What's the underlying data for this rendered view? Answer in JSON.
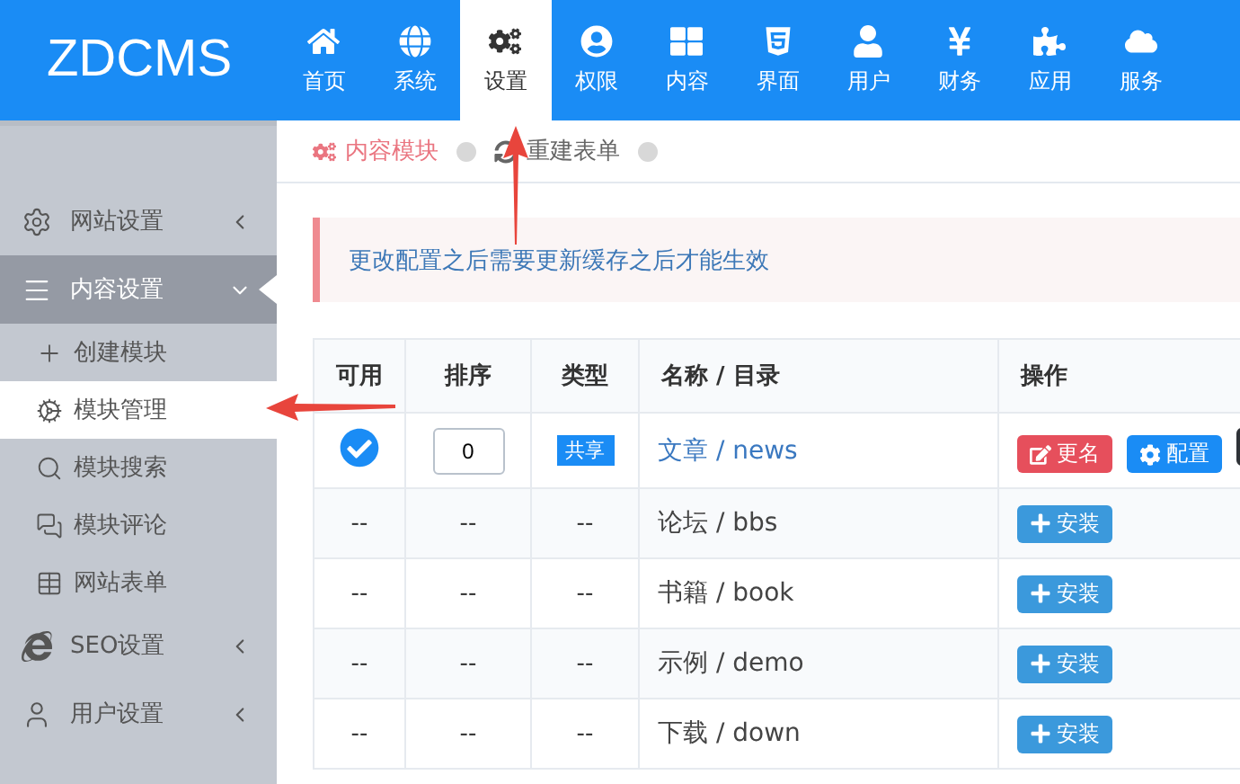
{
  "logo": "ZDCMS",
  "nav": [
    {
      "label": "首页",
      "selected": false
    },
    {
      "label": "系统",
      "selected": false
    },
    {
      "label": "设置",
      "selected": true
    },
    {
      "label": "权限",
      "selected": false
    },
    {
      "label": "内容",
      "selected": false
    },
    {
      "label": "界面",
      "selected": false
    },
    {
      "label": "用户",
      "selected": false
    },
    {
      "label": "财务",
      "selected": false
    },
    {
      "label": "应用",
      "selected": false
    },
    {
      "label": "服务",
      "selected": false
    }
  ],
  "sidebar": [
    {
      "label": "网站设置",
      "selected": false,
      "expanded": false
    },
    {
      "label": "内容设置",
      "selected": true,
      "expanded": true,
      "children": [
        {
          "label": "创建模块",
          "selected": false
        },
        {
          "label": "模块管理",
          "selected": true
        },
        {
          "label": "模块搜索",
          "selected": false
        },
        {
          "label": "模块评论",
          "selected": false
        },
        {
          "label": "网站表单",
          "selected": false
        }
      ]
    },
    {
      "label": "SEO设置",
      "selected": false,
      "expanded": false
    },
    {
      "label": "用户设置",
      "selected": false,
      "expanded": false
    }
  ],
  "breadcrumb": [
    {
      "label": "内容模块",
      "selected": true
    },
    {
      "label": "重建表单",
      "selected": false
    }
  ],
  "alert": "更改配置之后需要更新缓存之后才能生效",
  "table": {
    "columns": [
      "可用",
      "排序",
      "类型",
      "名称 / 目录",
      "操作"
    ],
    "rows": [
      {
        "kind": "installed",
        "enabled": true,
        "order": "0",
        "type": "共享",
        "name": "文章 / news",
        "actions": [
          {
            "kind": "rename",
            "label": "更名"
          },
          {
            "kind": "config",
            "label": "配置"
          },
          {
            "kind": "more"
          }
        ]
      },
      {
        "kind": "available",
        "placeholders": [
          "--",
          "--",
          "--"
        ],
        "name": "论坛 / bbs",
        "actions": [
          {
            "kind": "install",
            "label": "安装"
          }
        ]
      },
      {
        "kind": "available",
        "placeholders": [
          "--",
          "--",
          "--"
        ],
        "name": "书籍 / book",
        "actions": [
          {
            "kind": "install",
            "label": "安装"
          }
        ]
      },
      {
        "kind": "available",
        "placeholders": [
          "--",
          "--",
          "--"
        ],
        "name": "示例 / demo",
        "actions": [
          {
            "kind": "install",
            "label": "安装"
          }
        ]
      },
      {
        "kind": "available",
        "placeholders": [
          "--",
          "--",
          "--"
        ],
        "name": "下载 / down",
        "actions": [
          {
            "kind": "install",
            "label": "安装"
          }
        ]
      }
    ]
  }
}
